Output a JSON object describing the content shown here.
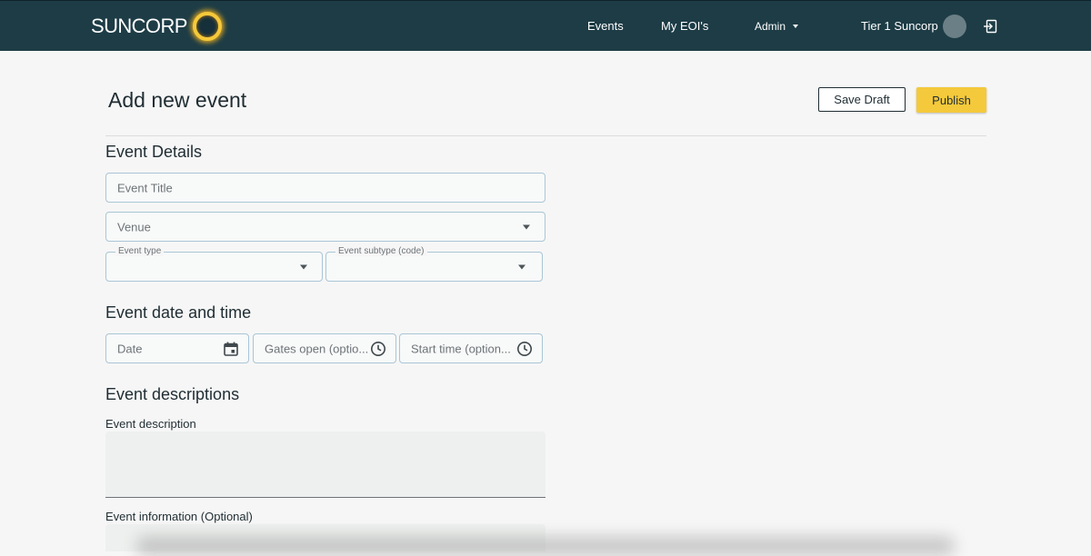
{
  "header": {
    "logo_text": "SUNCORP",
    "nav": {
      "events": "Events",
      "my_eois": "My EOI's",
      "admin": "Admin"
    },
    "user_name": "Tier 1 Suncorp",
    "colors": {
      "bar": "#1d3c46",
      "accent": "#f4c93b"
    }
  },
  "page": {
    "title": "Add new event",
    "save_draft": "Save Draft",
    "publish": "Publish"
  },
  "details": {
    "heading": "Event Details",
    "event_title_placeholder": "Event Title",
    "venue_placeholder": "Venue",
    "event_type_label": "Event type",
    "event_subtype_label": "Event subtype (code)"
  },
  "datetime": {
    "heading": "Event date and time",
    "date_placeholder": "Date",
    "gates_open_placeholder": "Gates open (optio...",
    "start_time_placeholder": "Start time (option..."
  },
  "descriptions": {
    "heading": "Event descriptions",
    "description_label": "Event description",
    "information_label": "Event information (Optional)"
  }
}
